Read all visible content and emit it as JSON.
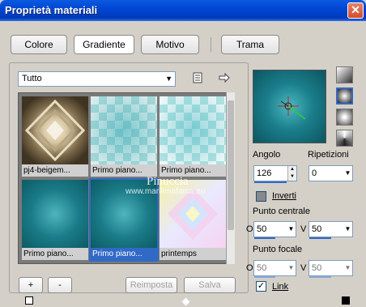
{
  "window": {
    "title": "Proprietà materiali",
    "close_glyph": "✕"
  },
  "tabs": [
    {
      "label": "Colore"
    },
    {
      "label": "Gradiente"
    },
    {
      "label": "Motivo"
    },
    {
      "label": "Trama"
    }
  ],
  "library": {
    "category": "Tutto",
    "items": [
      {
        "caption": "pj4-beigem..."
      },
      {
        "caption": "Primo piano..."
      },
      {
        "caption": "Primo piano..."
      },
      {
        "caption": "Primo piano..."
      },
      {
        "caption": "Primo piano..."
      },
      {
        "caption": "printemps"
      }
    ],
    "watermark": "Pinuccia",
    "watermark_url": "www.marilenafarca.eu"
  },
  "bottom_buttons": {
    "add": "+",
    "remove": "-",
    "reset": "Reimposta",
    "save": "Salva"
  },
  "properties": {
    "angle_label": "Angolo",
    "angle_value": "126",
    "repeat_label": "Ripetizioni",
    "repeat_value": "0",
    "invert_label": "Inverti",
    "center_label": "Punto centrale",
    "center_h_label": "O",
    "center_h": "50",
    "center_v_label": "V",
    "center_v": "50",
    "focal_label": "Punto focale",
    "focal_h_label": "O",
    "focal_h": "50",
    "focal_v_label": "V",
    "focal_v": "50",
    "link_label": "Link"
  }
}
